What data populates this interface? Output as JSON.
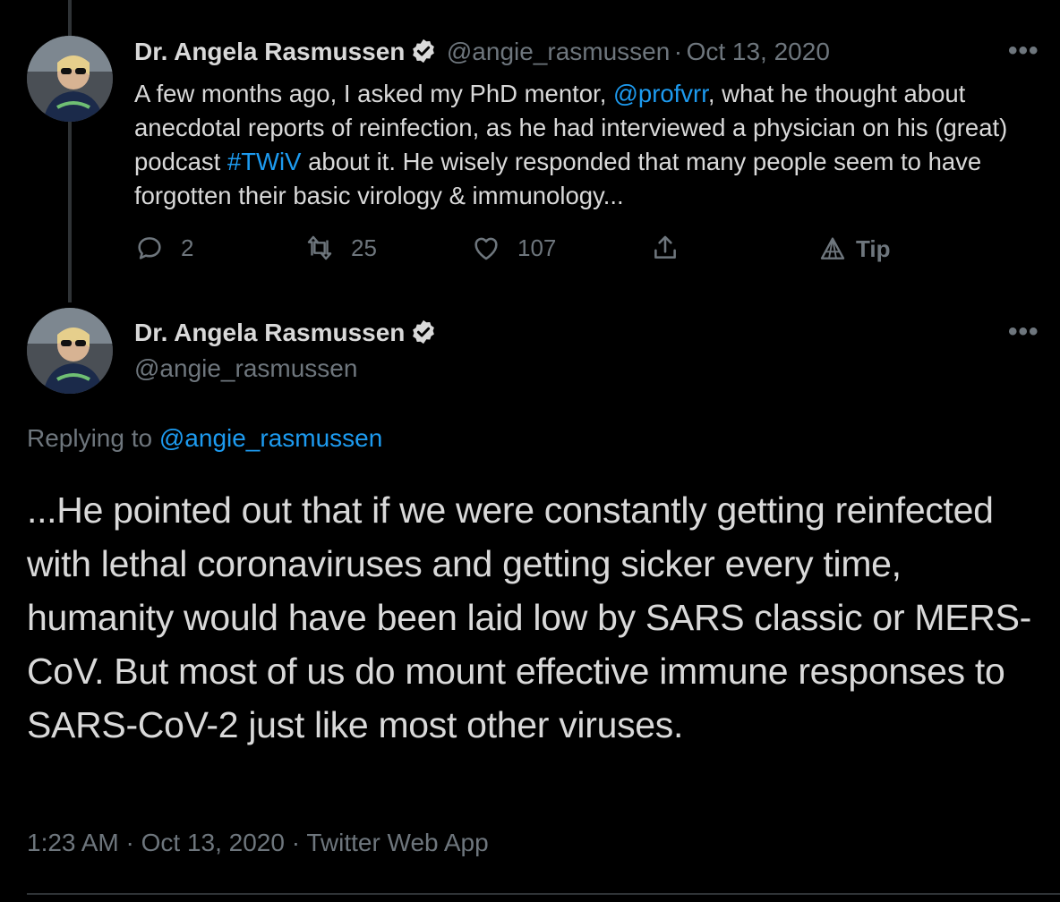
{
  "tweet1": {
    "author_name": "Dr. Angela Rasmussen",
    "handle": "@angie_rasmussen",
    "sep": "·",
    "date": "Oct 13, 2020",
    "text_parts": [
      "A few months ago, I asked my PhD mentor, ",
      "@profvrr",
      ", what he thought about anecdotal reports of reinfection, as he had interviewed a physician on his (great) podcast ",
      "#TWiV",
      " about it. He wisely responded that many people seem to have forgotten their basic virology & immunology..."
    ],
    "actions": {
      "reply_count": "2",
      "retweet_count": "25",
      "like_count": "107",
      "tip_label": "Tip"
    },
    "more_label": "•••"
  },
  "tweet2": {
    "author_name": "Dr. Angela Rasmussen",
    "handle": "@angie_rasmussen",
    "more_label": "•••",
    "replying_to_label": "Replying to ",
    "replying_to_handle": "@angie_rasmussen",
    "text": "...He pointed out that if we were constantly getting reinfected with lethal coronaviruses and getting sicker every time, humanity would have been laid low by SARS classic or MERS-CoV. But most of us do mount effective immune responses to SARS-CoV-2 just like most other viruses.",
    "meta": "1:23 AM · Oct 13, 2020 · Twitter Web App"
  },
  "colors": {
    "background": "#000000",
    "text": "#d9d9d9",
    "muted": "#6e767d",
    "link": "#1d9bf0"
  },
  "icons": [
    "verified-badge-icon",
    "more-icon",
    "reply-icon",
    "retweet-icon",
    "like-icon",
    "share-icon",
    "tip-icon"
  ]
}
